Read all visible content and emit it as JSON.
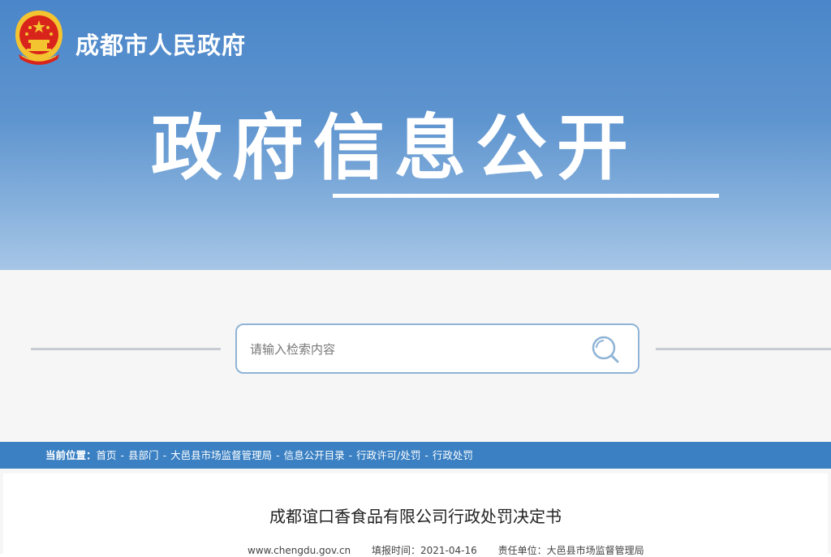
{
  "header": {
    "site_title": "成都市人民政府",
    "banner_title": "政府信息公开"
  },
  "search": {
    "placeholder": "请输入检索内容"
  },
  "breadcrumb": {
    "label": "当前位置：",
    "items": [
      "首页",
      "县部门",
      "大邑县市场监督管理局",
      "信息公开目录",
      "行政许可/处罚",
      "行政处罚"
    ],
    "separator": "-"
  },
  "article": {
    "title": "成都谊口香食品有限公司行政处罚决定书",
    "source": "www.chengdu.gov.cn",
    "date": "填报时间：2021-04-16",
    "unit": "责任单位：大邑县市场监督管理局"
  },
  "colors": {
    "banner_top": "#4a86c9",
    "breadcrumb_bg": "#3a80c3",
    "emblem_red": "#d8241b",
    "emblem_gold": "#f4c430"
  }
}
